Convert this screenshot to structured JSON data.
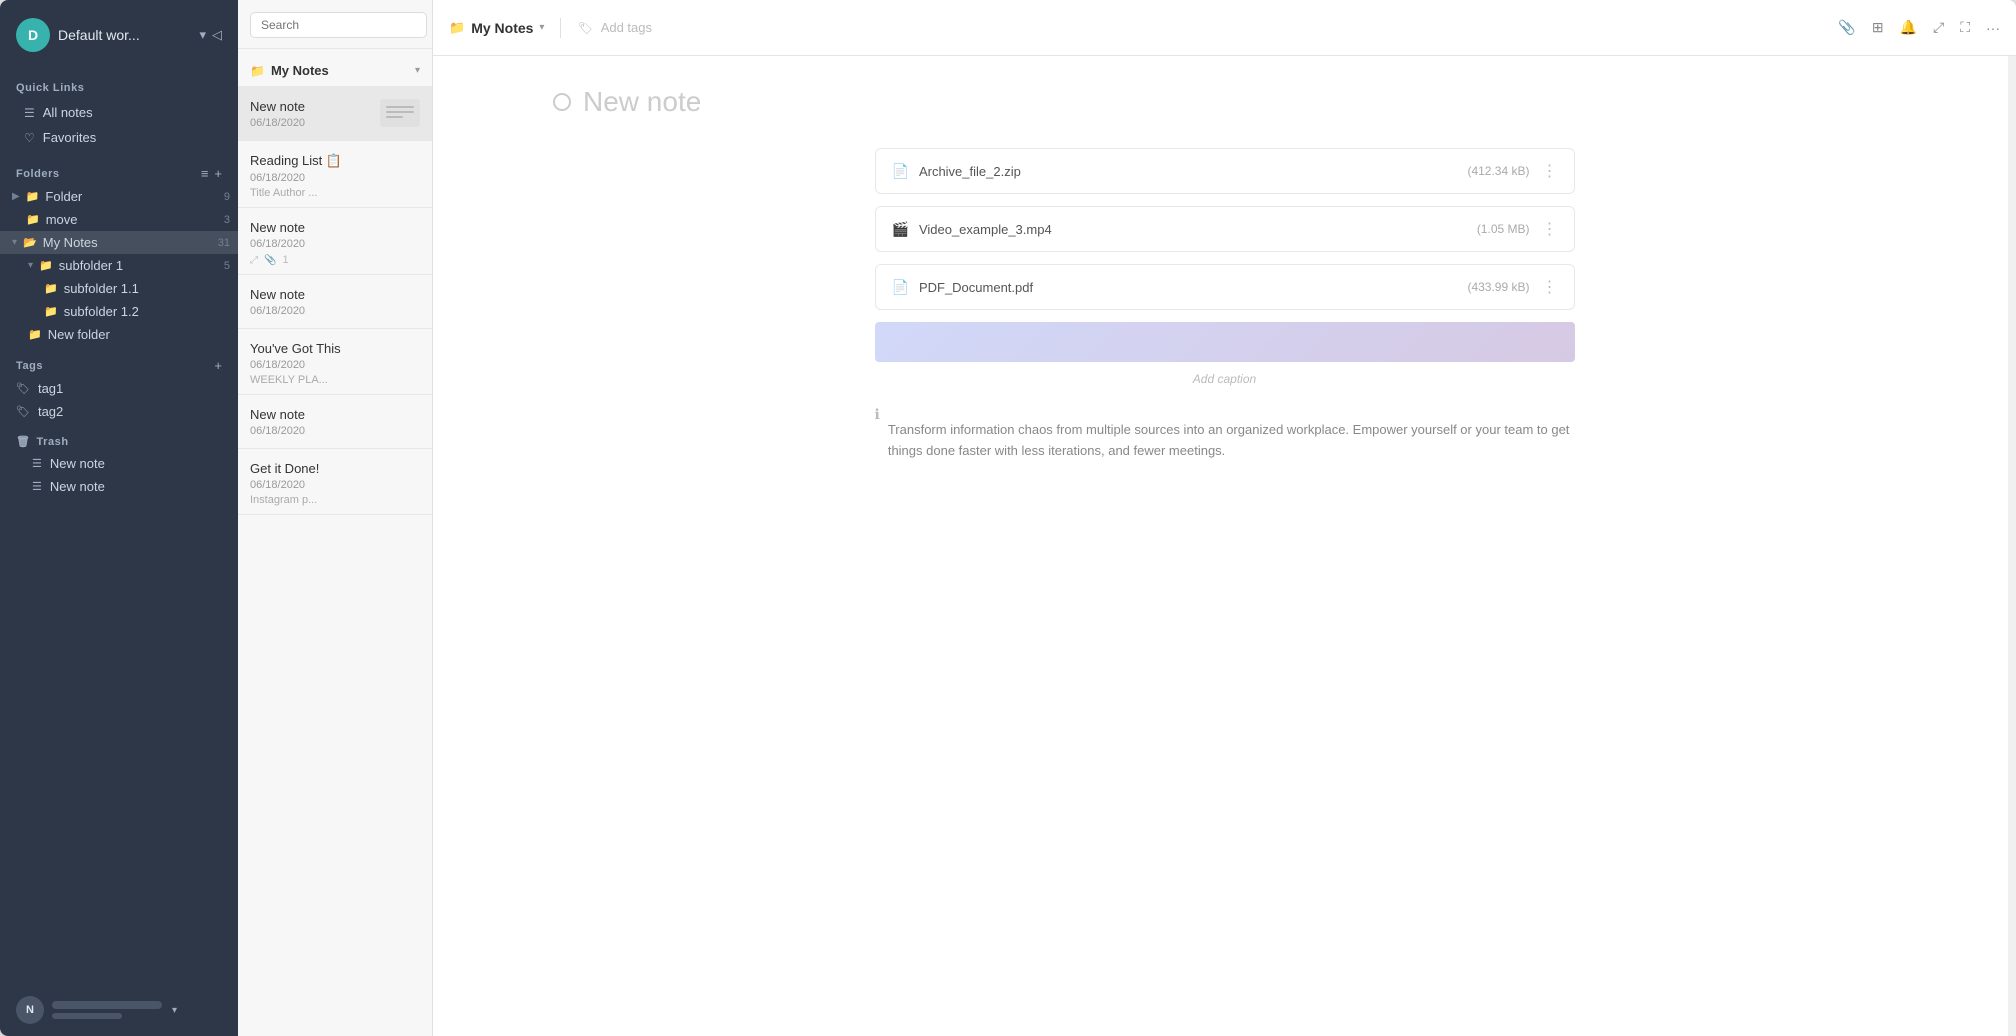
{
  "sidebar": {
    "avatar_letter": "D",
    "workspace_name": "Default wor...",
    "quick_links_title": "Quick Links",
    "all_notes_label": "All notes",
    "favorites_label": "Favorites",
    "folders_title": "Folders",
    "folders": [
      {
        "name": "Folder",
        "count": "9",
        "level": 0,
        "collapsed": true
      },
      {
        "name": "move",
        "count": "3",
        "level": 0,
        "collapsed": false
      },
      {
        "name": "My Notes",
        "count": "31",
        "level": 0,
        "collapsed": false,
        "active": true
      },
      {
        "name": "subfolder 1",
        "count": "5",
        "level": 1,
        "collapsed": false
      },
      {
        "name": "subfolder 1.1",
        "count": "",
        "level": 2
      },
      {
        "name": "subfolder 1.2",
        "count": "",
        "level": 2
      },
      {
        "name": "New folder",
        "count": "",
        "level": 1
      }
    ],
    "tags_title": "Tags",
    "tags": [
      {
        "name": "tag1"
      },
      {
        "name": "tag2"
      }
    ],
    "trash_title": "Trash",
    "trash_notes": [
      {
        "title": "New note"
      },
      {
        "title": "New note"
      }
    ],
    "footer_avatar": "N",
    "footer_name_visible": true
  },
  "notes_panel": {
    "folder_name": "My Notes",
    "search_placeholder": "Search",
    "notes": [
      {
        "title": "New note",
        "date": "06/18/2020",
        "preview": "",
        "has_thumb": true
      },
      {
        "title": "Reading List",
        "date": "06/18/2020",
        "preview": "Title Author ..."
      },
      {
        "title": "New note",
        "date": "06/18/2020",
        "preview": "",
        "has_share": true,
        "attachment_count": "1"
      },
      {
        "title": "New note",
        "date": "06/18/2020",
        "preview": ""
      },
      {
        "title": "You've Got This",
        "date": "06/18/2020",
        "preview": "WEEKLY PLA..."
      },
      {
        "title": "New note",
        "date": "06/18/2020",
        "preview": ""
      },
      {
        "title": "Get it Done!",
        "date": "06/18/2020",
        "preview": "Instagram p..."
      }
    ]
  },
  "topbar": {
    "folder_icon": "🗂",
    "title": "My Notes",
    "add_tags_label": "Add tags",
    "icons": [
      "📎",
      "⊞",
      "🔔",
      "⤢",
      "⋯"
    ]
  },
  "main_note": {
    "title": "New note",
    "attachments": [
      {
        "name": "Archive_file_2.zip",
        "size": "(412.34 kB)"
      },
      {
        "name": "Video_example_3.mp4",
        "size": "(1.05 MB)"
      },
      {
        "name": "PDF_Document.pdf",
        "size": "(433.99 kB)"
      }
    ],
    "caption_placeholder": "Add caption",
    "body_text": "Transform information chaos from multiple sources into an organized workplace. Empower yourself or your team to get things done faster with less iterations, and fewer meetings."
  }
}
